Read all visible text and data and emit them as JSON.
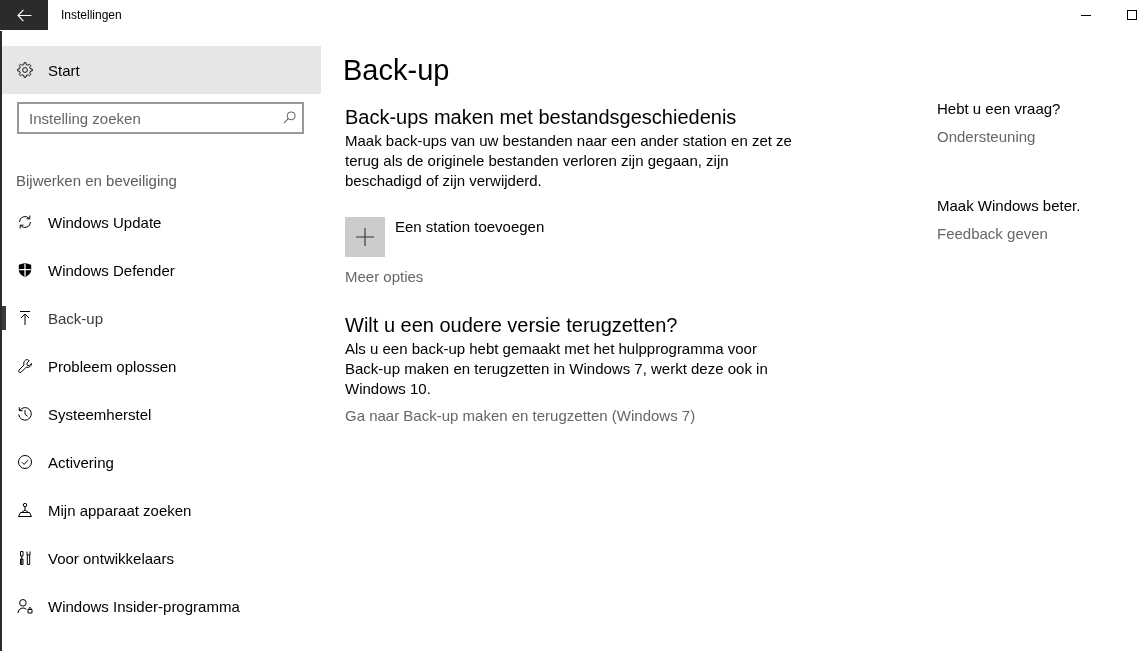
{
  "window": {
    "title": "Instellingen"
  },
  "sidebar": {
    "home": {
      "label": "Start"
    },
    "search": {
      "placeholder": "Instelling zoeken"
    },
    "category": "Bijwerken en beveiliging",
    "items": [
      {
        "label": "Windows Update",
        "selected": false
      },
      {
        "label": "Windows Defender",
        "selected": false
      },
      {
        "label": "Back-up",
        "selected": true
      },
      {
        "label": "Probleem oplossen",
        "selected": false
      },
      {
        "label": "Systeemherstel",
        "selected": false
      },
      {
        "label": "Activering",
        "selected": false
      },
      {
        "label": "Mijn apparaat zoeken",
        "selected": false
      },
      {
        "label": "Voor ontwikkelaars",
        "selected": false
      },
      {
        "label": "Windows Insider-programma",
        "selected": false
      }
    ]
  },
  "main": {
    "title": "Back-up",
    "sections": [
      {
        "heading": "Back-ups maken met bestandsgeschiedenis",
        "description": "Maak back-ups van uw bestanden naar een ander station en zet ze terug als de originele bestanden verloren zijn gegaan, zijn beschadigd of zijn verwijderd.",
        "add_drive": {
          "label": "Een station toevoegen"
        },
        "link": "Meer opties"
      },
      {
        "heading": "Wilt u een oudere versie terugzetten?",
        "description": "Als u een back-up hebt gemaakt met het hulpprogramma voor Back-up maken en terugzetten in Windows 7, werkt deze ook in Windows 10.",
        "link": "Ga naar Back-up maken en terugzetten (Windows 7)"
      }
    ]
  },
  "aside": [
    {
      "heading": "Hebt u een vraag?",
      "link": "Ondersteuning"
    },
    {
      "heading": "Maak Windows beter.",
      "link": "Feedback geven"
    }
  ]
}
